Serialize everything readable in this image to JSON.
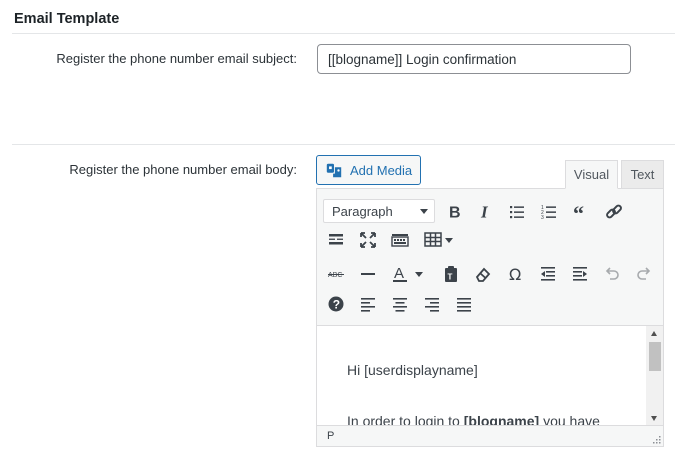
{
  "section": {
    "title": "Email Template"
  },
  "subject": {
    "label": "Register the phone number email subject:",
    "value": "[[blogname]] Login confirmation"
  },
  "body": {
    "label": "Register the phone number email body:"
  },
  "editor": {
    "add_media_label": "Add Media",
    "tabs": {
      "visual": "Visual",
      "text": "Text"
    },
    "format_select": "Paragraph",
    "toolbar_icons": [
      "bold-icon",
      "italic-icon",
      "bullet-list-icon",
      "numbered-list-icon",
      "blockquote-icon",
      "link-icon",
      "read-more-icon",
      "fullscreen-icon",
      "keyboard-icon",
      "table-icon",
      "strikethrough-icon",
      "horizontal-rule-icon",
      "text-color-icon",
      "paste-text-icon",
      "clear-formatting-icon",
      "special-character-icon",
      "outdent-icon",
      "indent-icon",
      "undo-icon",
      "redo-icon",
      "help-icon",
      "align-left-icon",
      "align-center-icon",
      "align-right-icon",
      "justify-icon"
    ],
    "content": {
      "line1": "Hi [userdisplayname]",
      "line2_prefix": "In order to login to ",
      "line2_bold": "[blogname]",
      "line2_suffix": " you have"
    },
    "status_path": "P"
  }
}
